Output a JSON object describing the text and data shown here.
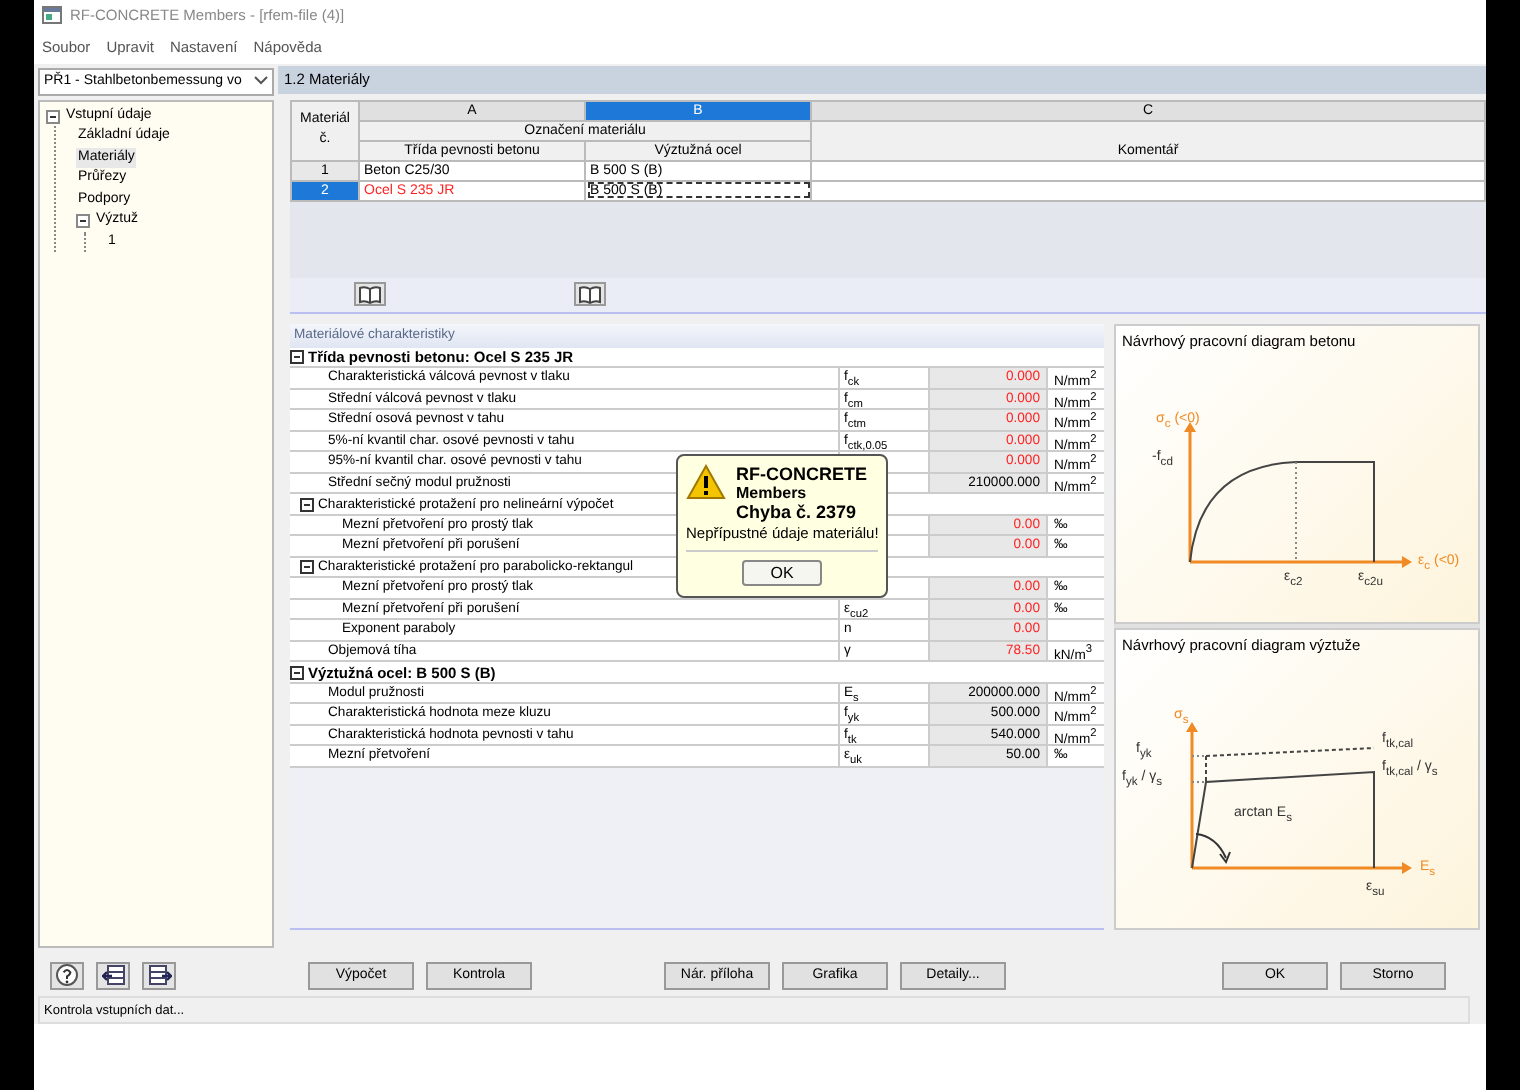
{
  "window": {
    "title": "RF-CONCRETE Members - [rfem-file (4)]"
  },
  "menu": [
    "Soubor",
    "Upravit",
    "Nastavení",
    "Nápověda"
  ],
  "case_selector": {
    "value": "PŘ1 - Stahlbetonbemessung vo"
  },
  "tree": [
    {
      "label": "Vstupní údaje",
      "expanded": true,
      "selected": false,
      "children": [
        {
          "label": "Základní údaje",
          "selected": false
        },
        {
          "label": "Materiály",
          "selected": true
        },
        {
          "label": "Průřezy",
          "selected": false
        },
        {
          "label": "Podpory",
          "selected": false
        },
        {
          "label": "Výztuž",
          "expanded": true,
          "selected": false,
          "children": [
            {
              "label": "1",
              "selected": false
            }
          ]
        }
      ]
    }
  ],
  "page_title": "1.2 Materiály",
  "materials_table": {
    "number_header": "Materiál č.",
    "group_header": "Označení materiálu",
    "columns": [
      {
        "letter": "A",
        "title": "Třída pevnosti betonu",
        "selected": false
      },
      {
        "letter": "B",
        "title": "Výztužná ocel",
        "selected": true
      },
      {
        "letter": "C",
        "title": "Komentář",
        "selected": false
      }
    ],
    "rows": [
      {
        "number": "1",
        "selected": false,
        "cells": [
          {
            "text": "Beton C25/30",
            "invalid": false,
            "focused": false
          },
          {
            "text": "B 500 S (B)",
            "invalid": false,
            "focused": false
          }
        ]
      },
      {
        "number": "2",
        "selected": true,
        "cells": [
          {
            "text": "Ocel S 235 JR",
            "invalid": true,
            "focused": false
          },
          {
            "text": "B 500 S (B)",
            "invalid": false,
            "focused": true
          }
        ]
      }
    ]
  },
  "properties": {
    "title": "Materiálové charakteristiky",
    "sections": [
      {
        "title": "Třída pevnosti betonu: Ocel S 235 JR",
        "expanded": true,
        "items": [
          {
            "kind": "param",
            "label": "Charakteristická válcová pevnost v tlaku",
            "symbol": "f$_{ck}$",
            "value": "0.000",
            "unit": "N/mm$^{2}$",
            "invalid": true
          },
          {
            "kind": "param",
            "label": "Střední válcová pevnost v tlaku",
            "symbol": "f$_{cm}$",
            "value": "0.000",
            "unit": "N/mm$^{2}$",
            "invalid": true
          },
          {
            "kind": "param",
            "label": "Střední osová pevnost v tahu",
            "symbol": "f$_{ctm}$",
            "value": "0.000",
            "unit": "N/mm$^{2}$",
            "invalid": true
          },
          {
            "kind": "param",
            "label": "5%-ní kvantil char. osové pevnosti v tahu",
            "symbol": "f$_{ctk,0.05}$",
            "value": "0.000",
            "unit": "N/mm$^{2}$",
            "invalid": true
          },
          {
            "kind": "param",
            "label": "95%-ní kvantil char. osové pevnosti v tahu",
            "value": "0.000",
            "unit": "N/mm$^{2}$",
            "invalid": true
          },
          {
            "kind": "param",
            "label": "Střední sečný modul pružnosti",
            "value": "210000.000",
            "unit": "N/mm$^{2}$",
            "invalid": false
          },
          {
            "kind": "group",
            "title": "Charakteristické protažení pro nelineární výpočet",
            "expanded": true,
            "items": [
              {
                "kind": "param",
                "label": "Mezní přetvoření pro prostý tlak",
                "value": "0.00",
                "unit": "‰",
                "invalid": true
              },
              {
                "kind": "param",
                "label": "Mezní přetvoření při porušení",
                "value": "0.00",
                "unit": "‰",
                "invalid": true
              }
            ]
          },
          {
            "kind": "group",
            "title": "Charakteristické protažení pro parabolicko-rektangul",
            "expanded": true,
            "items": [
              {
                "kind": "param",
                "label": "Mezní přetvoření pro prostý tlak",
                "value": "0.00",
                "unit": "‰",
                "invalid": true
              },
              {
                "kind": "param",
                "label": "Mezní přetvoření při porušení",
                "symbol": "ε$_{cu2}$",
                "value": "0.00",
                "unit": "‰",
                "invalid": true
              },
              {
                "kind": "param",
                "label": "Exponent paraboly",
                "symbol": "n",
                "value": "0.00",
                "invalid": true
              }
            ]
          },
          {
            "kind": "param",
            "label": "Objemová tíha",
            "symbol": "γ",
            "value": "78.50",
            "unit": "kN/m$^{3}$",
            "invalid": true
          }
        ]
      },
      {
        "title": "Výztužná ocel: B 500 S (B)",
        "expanded": true,
        "items": [
          {
            "kind": "param",
            "label": "Modul pružnosti",
            "symbol": "E$_{s}$",
            "value": "200000.000",
            "unit": "N/mm$^{2}$",
            "invalid": false
          },
          {
            "kind": "param",
            "label": "Charakteristická hodnota meze kluzu",
            "symbol": "f$_{yk}$",
            "value": "500.000",
            "unit": "N/mm$^{2}$",
            "invalid": false
          },
          {
            "kind": "param",
            "label": "Charakteristická hodnota pevnosti v tahu",
            "symbol": "f$_{tk}$",
            "value": "540.000",
            "unit": "N/mm$^{2}$",
            "invalid": false
          },
          {
            "kind": "param",
            "label": "Mezní přetvoření",
            "symbol": "ε$_{uk}$",
            "value": "50.00",
            "unit": "‰",
            "invalid": false
          }
        ]
      }
    ]
  },
  "error_dialog": {
    "app": "RF-CONCRETE",
    "module": "Members",
    "code": "Chyba č. 2379",
    "message": "Nepřípustné údaje materiálu!",
    "button": "OK"
  },
  "diagrams": [
    {
      "kind": "concrete",
      "title": "Návrhový pracovní diagram betonu",
      "labels": [
        "σ$_{c}$ (<0)",
        "-f$_{cd}$",
        "ε$_{c2}$",
        "ε$_{c2u}$",
        "ε$_{c}$ (<0)"
      ]
    },
    {
      "kind": "steel",
      "title": "Návrhový pracovní diagram výztuže",
      "labels": [
        "σ$_{s}$",
        "f$_{yk}$",
        "f$_{yk}$ / γ$_{s}$",
        "arctan E$_{s}$",
        "f$_{tk,cal}$",
        "f$_{tk,cal}$ / γ$_{s}$",
        "ε$_{su}$",
        "E$_{s}$"
      ]
    }
  ],
  "buttons": [
    "Výpočet",
    "Kontrola",
    "Nár. příloha",
    "Grafika",
    "Detaily...",
    "OK",
    "Storno"
  ],
  "status_bar": "Kontrola vstupních dat..."
}
